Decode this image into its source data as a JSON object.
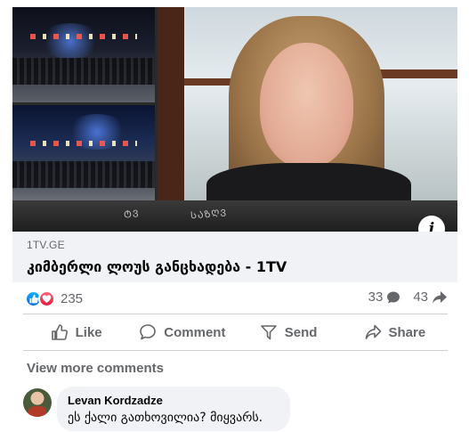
{
  "post": {
    "media": {
      "overlay_text_left": "ᲢᲕ",
      "overlay_text_right": "ᲡᲐᲖᲦᲕ",
      "info_label": "i",
      "info_icon": "info-icon"
    },
    "link": {
      "domain": "1TV.GE",
      "title": "კიმბერლი ლოუს განცხადება - 1TV"
    },
    "reactions": {
      "icons": [
        "like-reaction-icon",
        "love-reaction-icon"
      ],
      "count": "235",
      "comments_count": "33",
      "shares_count": "43"
    },
    "actions": {
      "like": "Like",
      "comment": "Comment",
      "send": "Send",
      "share": "Share"
    },
    "comments": {
      "view_more": "View more comments",
      "items": [
        {
          "author": "Levan Kordzadze",
          "text": "ეს ქალი გათხოვილია? მიყვარს."
        }
      ]
    }
  },
  "colors": {
    "like_blue": "#0866ff",
    "love_red": "#f33e58",
    "secondary_text": "#65676b",
    "link_bg": "#f0f2f5"
  }
}
